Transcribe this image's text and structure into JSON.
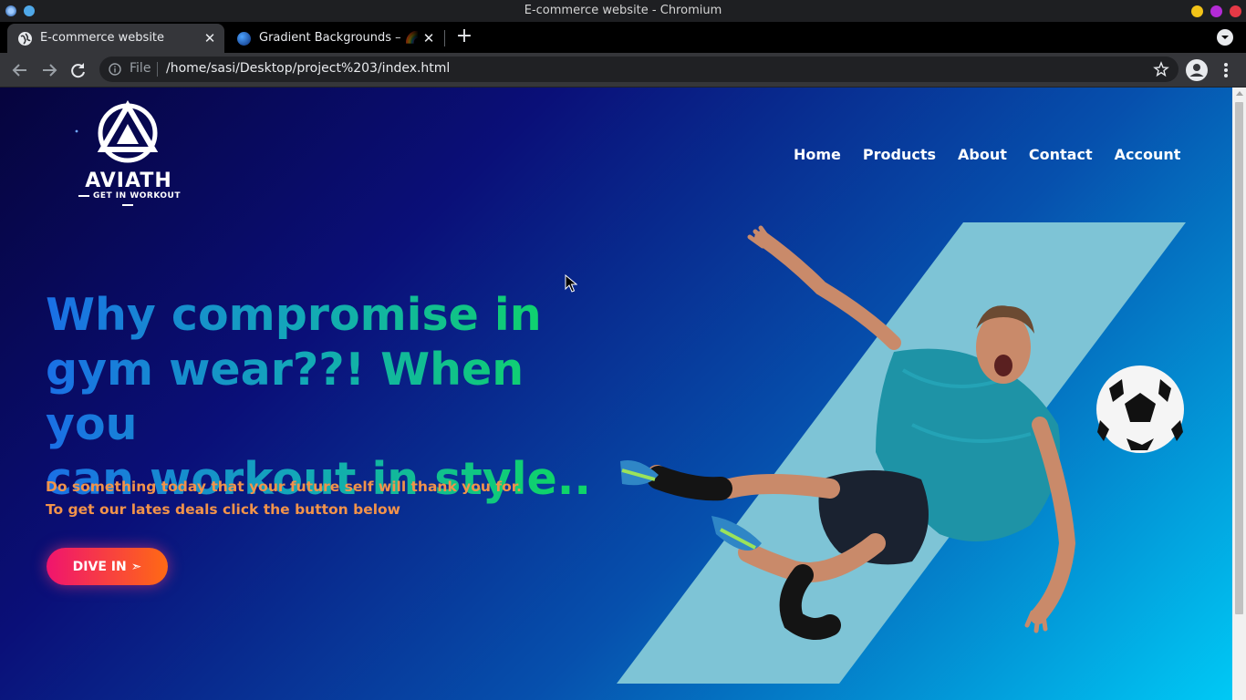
{
  "window": {
    "title": "E-commerce website - Chromium"
  },
  "tabs": [
    {
      "label": "E-commerce website",
      "active": true
    },
    {
      "label": "Gradient Backgrounds – 🌈 T",
      "active": false
    }
  ],
  "omnibox": {
    "scheme": "File",
    "url": "/home/sasi/Desktop/project%203/index.html"
  },
  "page": {
    "logo": {
      "brand": "AVIATH",
      "tagline": "GET IN WORKOUT"
    },
    "nav": [
      "Home",
      "Products",
      "About",
      "Contact",
      "Account"
    ],
    "headline": {
      "line1": "Why compromise in",
      "line2": "gym wear??! When you",
      "line3": "can workout in style.."
    },
    "subtext": {
      "line1": "Do something today that your future self will thank you for.",
      "line2": "To get our lates deals click the button below"
    },
    "cta": {
      "label": "DIVE IN ➣"
    }
  },
  "colors": {
    "gradient_start": "#06043d",
    "gradient_mid": "#0650ad",
    "gradient_end": "#00c9f5",
    "headline_blue": "#1a6fe6",
    "headline_green": "#0fd46a",
    "subtext_orange": "#f2934a",
    "cta_pink": "#f0146e",
    "cta_orange": "#ff6a14",
    "art_parallelogram": "#7ec4d6",
    "jersey_teal": "#1e93a6"
  }
}
